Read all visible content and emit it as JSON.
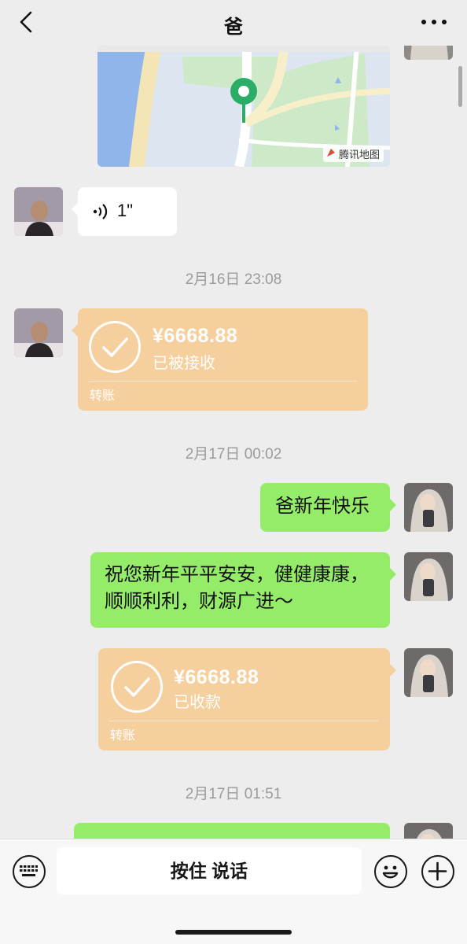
{
  "header": {
    "title": "爸"
  },
  "map": {
    "provider_label": "腾讯地图"
  },
  "messages": {
    "voice_duration": "1\"",
    "timestamp_1": "2月16日 23:08",
    "transfer_in": {
      "amount": "¥6668.88",
      "status": "已被接收",
      "type": "转账"
    },
    "timestamp_2": "2月17日 00:02",
    "text_1": "爸新年快乐",
    "text_2_line1": "祝您新年平平安安，健健康康，",
    "text_2_line2": "顺顺利利，财源广进～",
    "transfer_out": {
      "amount": "¥6668.88",
      "status": "已收款",
      "type": "转账"
    },
    "timestamp_3": "2月17日 01:51"
  },
  "input_bar": {
    "voice_button_label": "按住 说话",
    "left_icon": "keyboard-icon",
    "emoji_icon": "emoji-icon",
    "plus_icon": "plus-icon"
  },
  "colors": {
    "background": "#ededed",
    "green_bubble": "#95ec69",
    "transfer_bubble": "#f6cf9e",
    "map_pin": "#2aae67"
  }
}
